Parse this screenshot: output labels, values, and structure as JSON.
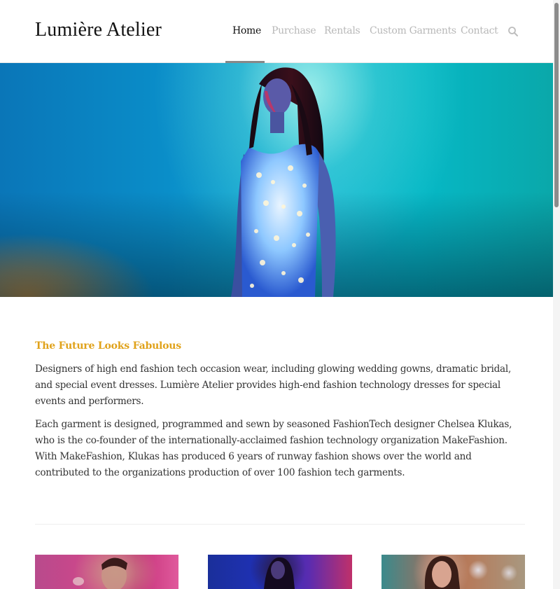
{
  "site": {
    "logo": "Lumière Atelier"
  },
  "nav": {
    "items": [
      {
        "label": "Home",
        "active": true
      },
      {
        "label": "Purchase",
        "active": false
      },
      {
        "label": "Rentals",
        "active": false
      },
      {
        "label": "Custom Garments",
        "active": false
      },
      {
        "label": "Contact",
        "active": false
      }
    ],
    "search_icon": "search-icon"
  },
  "colors": {
    "accent": "#e0a21a",
    "nav_active": "#111111",
    "nav_inactive": "#b8b8b8",
    "text": "#333333"
  },
  "main": {
    "title": "The Future Looks Fabulous",
    "paragraphs": [
      "Designers of high end fashion tech occasion wear, including glowing wedding gowns, dramatic bridal, and special event dresses. Lumière Atelier provides high-end fashion technology dresses for special events and performers.",
      "Each garment is designed, programmed and sewn by seasoned FashionTech designer Chelsea Klukas, who is the co-founder of the internationally-acclaimed fashion technology organization MakeFashion. With MakeFashion, Klukas has produced 6 years of runway fashion shows over the world and contributed to the organizations production of over 100 fashion tech garments."
    ]
  }
}
